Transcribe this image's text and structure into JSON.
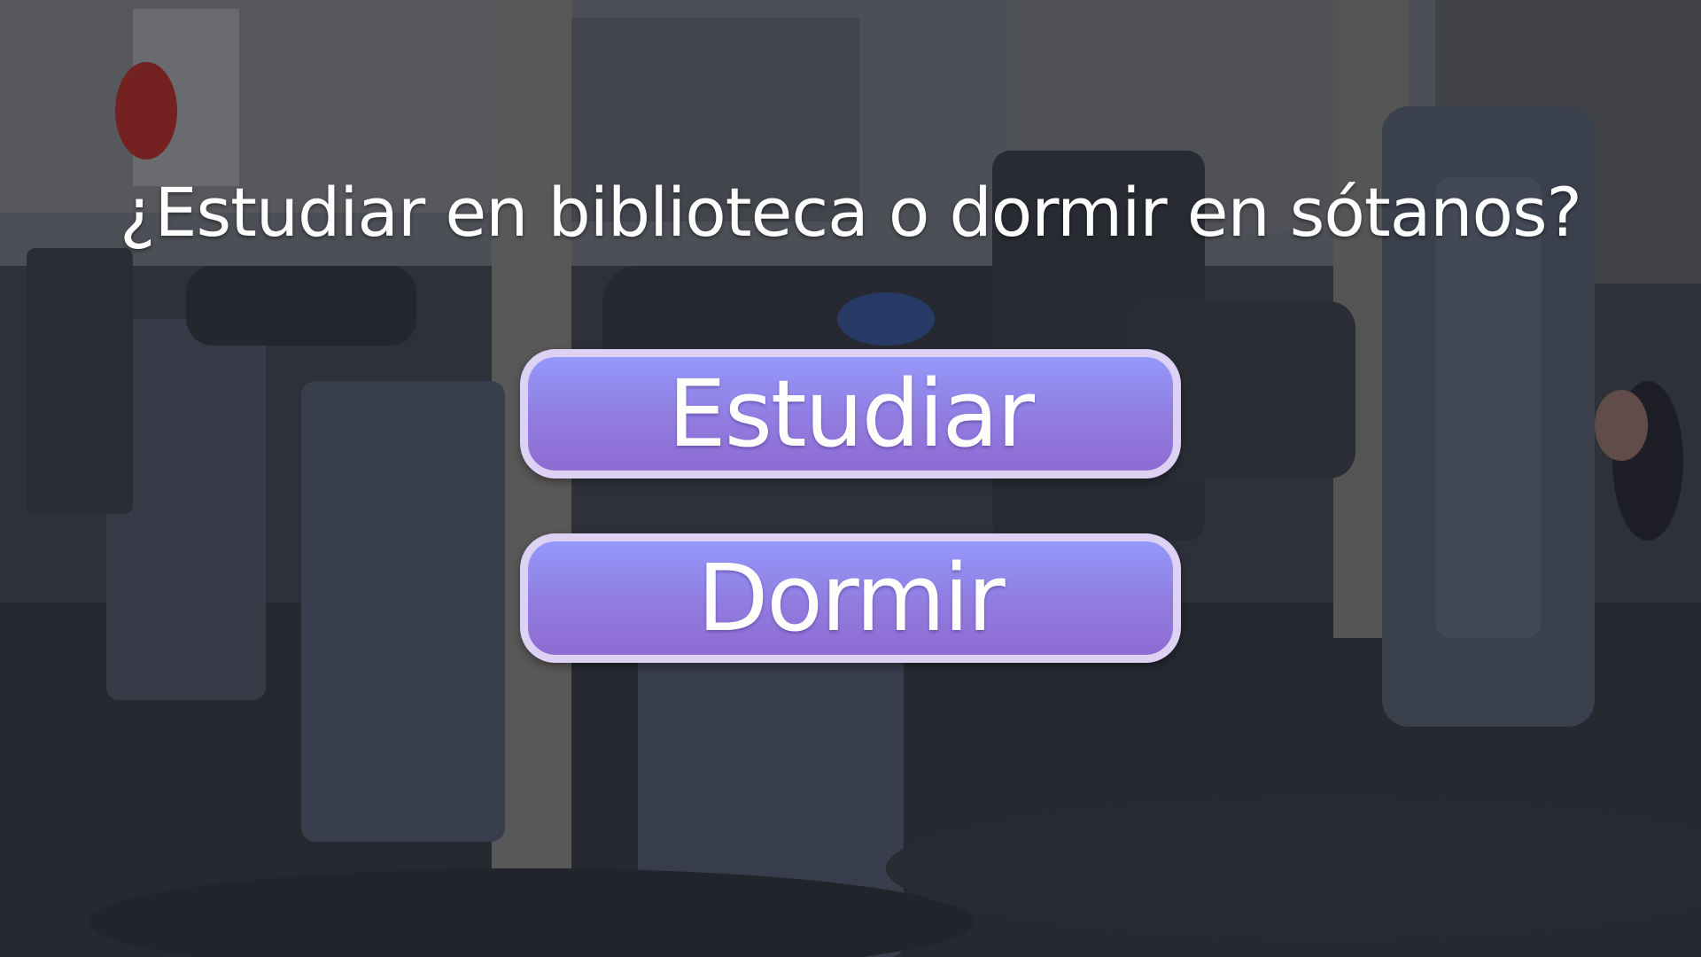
{
  "scene": {
    "background_icon": "gym-interior-illustration",
    "overlay_color": "#1d2029"
  },
  "question": {
    "text": "¿Estudiar en biblioteca o dormir en sótanos?"
  },
  "choices": [
    {
      "label": "Estudiar"
    },
    {
      "label": "Dormir"
    }
  ],
  "colors": {
    "button_top": "#9598fb",
    "button_bottom": "#8f6bd2",
    "button_border": "#ddd2f3",
    "text": "#ffffff"
  }
}
